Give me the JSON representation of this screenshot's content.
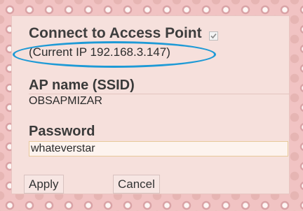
{
  "access_point": {
    "title": "Connect to Access Point",
    "checked": true,
    "ip_text": "(Current IP 192.168.3.147)"
  },
  "ssid": {
    "label": "AP name (SSID)",
    "value": "OBSAPMIZAR"
  },
  "password": {
    "label": "Password",
    "value": "whateverstar"
  },
  "buttons": {
    "apply": "Apply",
    "cancel": "Cancel"
  },
  "colors": {
    "annotation_oval": "#1e9ad6",
    "panel_background": "#f6e0dc",
    "page_pattern": "#f1c3c3"
  }
}
